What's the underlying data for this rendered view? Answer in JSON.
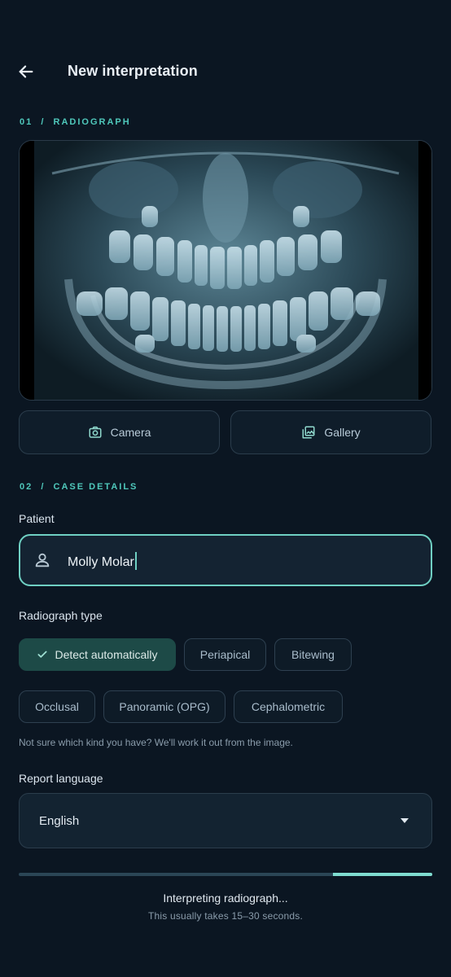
{
  "header": {
    "title": "New interpretation",
    "back_icon": "arrow-left-icon"
  },
  "section1": {
    "label": "01  /  RADIOGRAPH"
  },
  "radiograph": {
    "image": "panoramic-dental-radiograph"
  },
  "source_buttons": {
    "camera": {
      "label": "Camera",
      "icon": "camera-icon"
    },
    "gallery": {
      "label": "Gallery",
      "icon": "gallery-icon"
    }
  },
  "section2": {
    "label": "02  /  CASE DETAILS"
  },
  "patient": {
    "label": "Patient",
    "value": "Molly Molar",
    "icon": "person-icon"
  },
  "radiograph_type": {
    "label": "Radiograph type",
    "options": [
      {
        "label": "Detect automatically",
        "selected": true
      },
      {
        "label": "Periapical",
        "selected": false
      },
      {
        "label": "Bitewing",
        "selected": false
      },
      {
        "label": "Occlusal",
        "selected": false
      },
      {
        "label": "Panoramic (OPG)",
        "selected": false
      },
      {
        "label": "Cephalometric",
        "selected": false
      }
    ],
    "hint": "Not sure which kind you have? We'll work it out from the image."
  },
  "report_language": {
    "label": "Report language",
    "value": "English"
  },
  "progress": {
    "fraction": 0.24,
    "status": "Interpreting radiograph...",
    "subtext": "This usually takes 15–30 seconds."
  },
  "colors": {
    "accent": "#6fd0c3",
    "background": "#0b1622",
    "chip_selected": "#1d4a47"
  }
}
